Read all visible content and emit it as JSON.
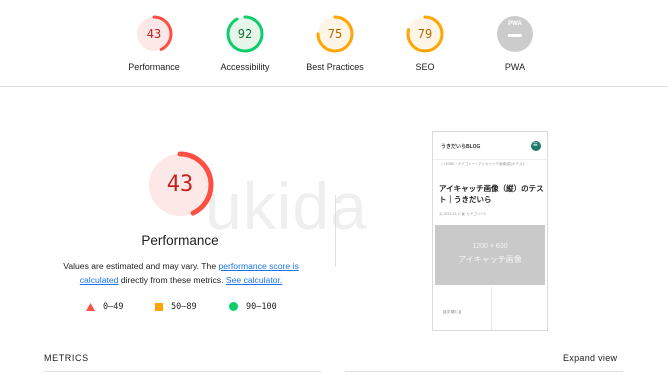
{
  "scores": [
    {
      "value": "43",
      "label": "Performance",
      "score": 43,
      "color": "#ff4e42",
      "fg": "#c5221f",
      "bg": "#fce8e6"
    },
    {
      "value": "92",
      "label": "Accessibility",
      "score": 92,
      "color": "#0cce6b",
      "fg": "#137333",
      "bg": "#e6f4ea"
    },
    {
      "value": "75",
      "label": "Best Practices",
      "score": 75,
      "color": "#ffa400",
      "fg": "#b26a00",
      "bg": "#fef5e6"
    },
    {
      "value": "79",
      "label": "SEO",
      "score": 79,
      "color": "#ffa400",
      "fg": "#b26a00",
      "bg": "#fef5e6"
    },
    {
      "value": "PWA",
      "label": "PWA",
      "score": null,
      "color": "#cccccc",
      "fg": "#ffffff",
      "bg": "#cccccc"
    }
  ],
  "performance": {
    "score": "43",
    "title": "Performance",
    "desc_prefix": "Values are estimated and may vary. The ",
    "link1": "performance score is calculated",
    "desc_middle": " directly from these metrics. ",
    "link2": "See calculator."
  },
  "legend": [
    {
      "range": "0–49",
      "shape": "triangle",
      "color": "#ff4e42"
    },
    {
      "range": "50–89",
      "shape": "square",
      "color": "#ffa400"
    },
    {
      "range": "90–100",
      "shape": "circle",
      "color": "#0cce6b"
    }
  ],
  "watermark": "ukida",
  "screenshot": {
    "site_logo": "うきだいらBLOG",
    "breadcrumb": "⌂ HOME  ›  カテゴリー  ›  アイキャッチ画像(縦)のテスト",
    "title": "アイキャッチ画像（縦）のテスト｜うきだいら",
    "meta": "▣ 2023.03.17   ◧ カテゴリー2",
    "image_text_1": "1200 × 630",
    "image_text_2": "アイキャッチ画像",
    "footer": "目次   閉じる"
  },
  "metrics": {
    "label": "METRICS",
    "expand": "Expand view"
  }
}
